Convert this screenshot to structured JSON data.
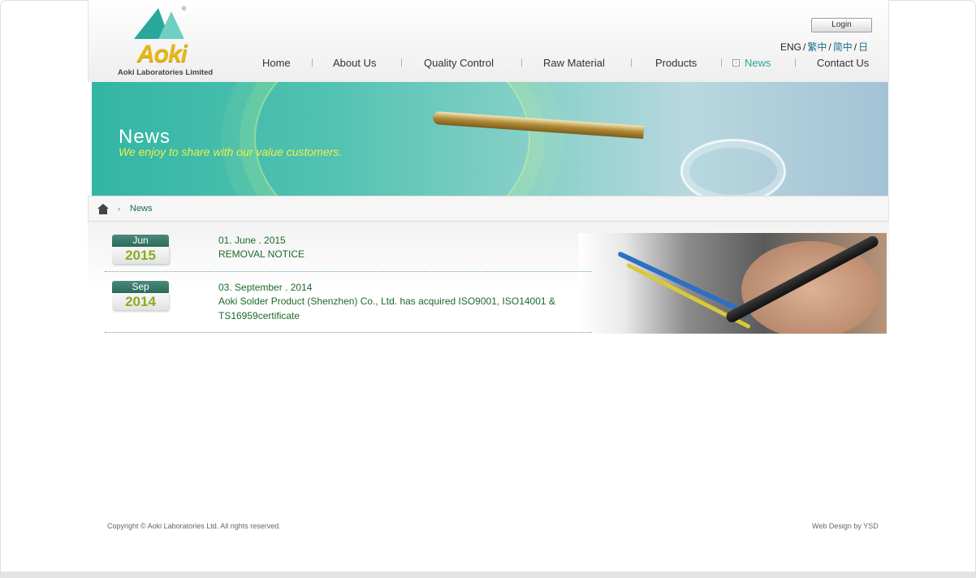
{
  "header": {
    "logo": {
      "company": "Aoki Laboratories Limited",
      "wordmark": "Aoki",
      "reg": "®"
    },
    "login_label": "Login",
    "languages": [
      {
        "label": "ENG"
      },
      {
        "label": "繁中"
      },
      {
        "label": "简中"
      },
      {
        "label": "日"
      }
    ],
    "lang_sep": "/",
    "nav": [
      {
        "label": "Home"
      },
      {
        "label": "About Us"
      },
      {
        "label": "Quality Control"
      },
      {
        "label": "Raw Material"
      },
      {
        "label": "Products"
      },
      {
        "label": "News"
      },
      {
        "label": "Contact Us"
      }
    ],
    "nav_sep": "|",
    "active_nav": "News"
  },
  "banner": {
    "title": "News",
    "subtitle": "We enjoy to share with our value customers."
  },
  "breadcrumb": {
    "arrow": "›",
    "current": "News"
  },
  "news": [
    {
      "month": "Jun",
      "year": "2015",
      "date": "01. June . 2015",
      "title": "REMOVAL NOTICE"
    },
    {
      "month": "Sep",
      "year": "2014",
      "date": "03. September . 2014",
      "title": "Aoki Solder Product (Shenzhen) Co., Ltd. has acquired ISO9001, ISO14001 & TS16959certificate"
    }
  ],
  "footer": {
    "copyright": "Copyright © Aoki Laboratories Ltd. All rights reserved.",
    "credit": "Web Design by YSD"
  },
  "colors": {
    "accent": "#2aa79b",
    "link_green": "#1c6a2a",
    "banner_subtitle": "#e7f24a",
    "year": "#8dab1d"
  }
}
